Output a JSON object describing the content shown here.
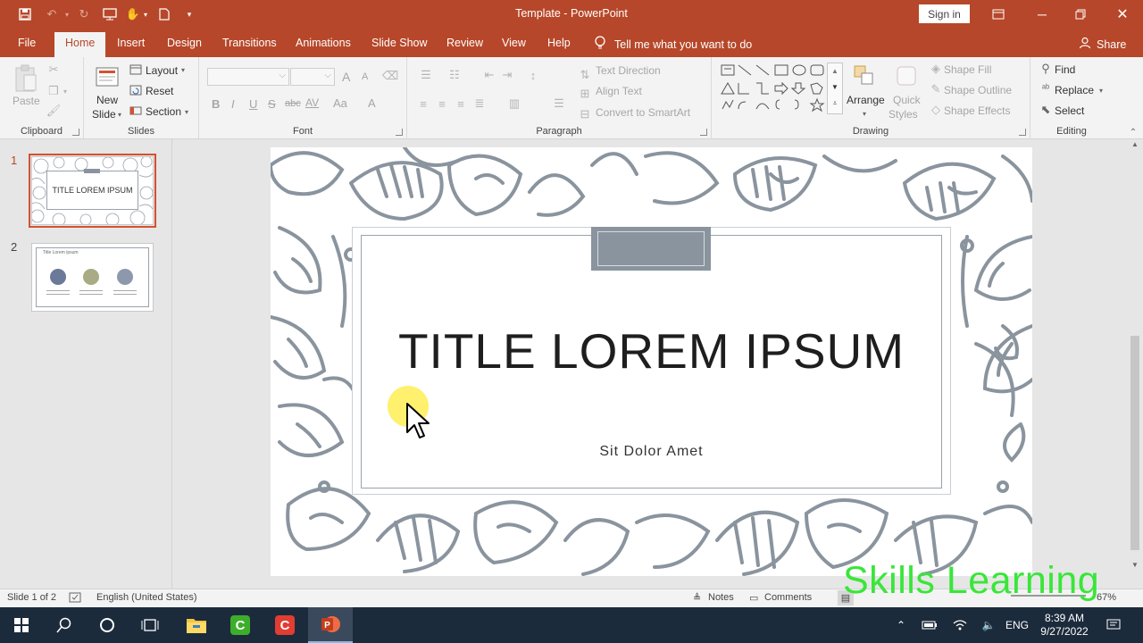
{
  "app": {
    "title": "Template  -  PowerPoint",
    "sign_in": "Sign in"
  },
  "tabs": [
    {
      "label": "File"
    },
    {
      "label": "Home"
    },
    {
      "label": "Insert"
    },
    {
      "label": "Design"
    },
    {
      "label": "Transitions"
    },
    {
      "label": "Animations"
    },
    {
      "label": "Slide Show"
    },
    {
      "label": "Review"
    },
    {
      "label": "View"
    },
    {
      "label": "Help"
    }
  ],
  "tell_me": "Tell me what you want to do",
  "share": "Share",
  "ribbon": {
    "clipboard": {
      "paste": "Paste",
      "label": "Clipboard"
    },
    "slides": {
      "new_slide_1": "New",
      "new_slide_2": "Slide",
      "layout": "Layout",
      "reset": "Reset",
      "section": "Section",
      "label": "Slides"
    },
    "font": {
      "label": "Font",
      "bold": "B",
      "italic": "I",
      "underline": "U",
      "strike": "S",
      "shadow": "abc",
      "spacing": "AV",
      "case": "Aa",
      "color": "A",
      "grow": "A",
      "shrink": "A"
    },
    "paragraph": {
      "text_direction": "Text Direction",
      "align_text": "Align Text",
      "smartart": "Convert to SmartArt",
      "label": "Paragraph"
    },
    "drawing": {
      "arrange": "Arrange",
      "quick_styles_1": "Quick",
      "quick_styles_2": "Styles",
      "shape_fill": "Shape Fill",
      "shape_outline": "Shape Outline",
      "shape_effects": "Shape Effects",
      "label": "Drawing"
    },
    "editing": {
      "find": "Find",
      "replace": "Replace",
      "select": "Select",
      "label": "Editing"
    }
  },
  "thumbnails": [
    {
      "number": "1",
      "title": "TITLE LOREM IPSUM"
    },
    {
      "number": "2",
      "title": "Title Lorem ipsum"
    }
  ],
  "slide": {
    "title": "TITLE LOREM IPSUM",
    "subtitle": "Sit Dolor Amet"
  },
  "status": {
    "slide_of": "Slide 1 of 2",
    "language": "English (United States)",
    "notes": "Notes",
    "comments": "Comments",
    "zoom": "67%"
  },
  "watermark": "Skills Learning",
  "taskbar": {
    "time": "8:39 AM",
    "date": "9/27/2022",
    "lang": "ENG"
  },
  "colors": {
    "accent": "#b7472a",
    "pattern": "#8a949e",
    "tab_bar": "#1c2b3c"
  }
}
